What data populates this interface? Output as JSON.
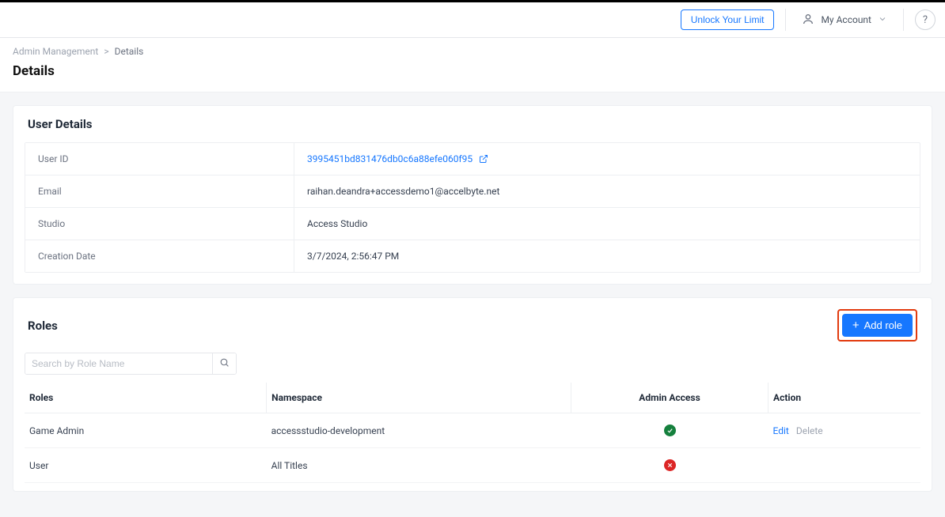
{
  "header": {
    "unlock_label": "Unlock Your Limit",
    "account_label": "My Account"
  },
  "breadcrumb": {
    "root": "Admin Management",
    "current": "Details"
  },
  "page_title": "Details",
  "user_details": {
    "title": "User Details",
    "rows": [
      {
        "label": "User ID",
        "value": "3995451bd831476db0c6a88efe060f95",
        "is_link": true
      },
      {
        "label": "Email",
        "value": "raihan.deandra+accessdemo1@accelbyte.net"
      },
      {
        "label": "Studio",
        "value": "Access Studio"
      },
      {
        "label": "Creation Date",
        "value": "3/7/2024, 2:56:47 PM"
      }
    ]
  },
  "roles": {
    "title": "Roles",
    "add_label": "Add role",
    "search_placeholder": "Search by Role Name",
    "columns": {
      "role": "Roles",
      "namespace": "Namespace",
      "admin": "Admin Access",
      "action": "Action"
    },
    "actions": {
      "edit": "Edit",
      "delete": "Delete"
    },
    "rows": [
      {
        "role": "Game Admin",
        "namespace": "accessstudio-development",
        "admin": true,
        "has_actions": true
      },
      {
        "role": "User",
        "namespace": "All Titles",
        "admin": false,
        "has_actions": false
      }
    ]
  }
}
